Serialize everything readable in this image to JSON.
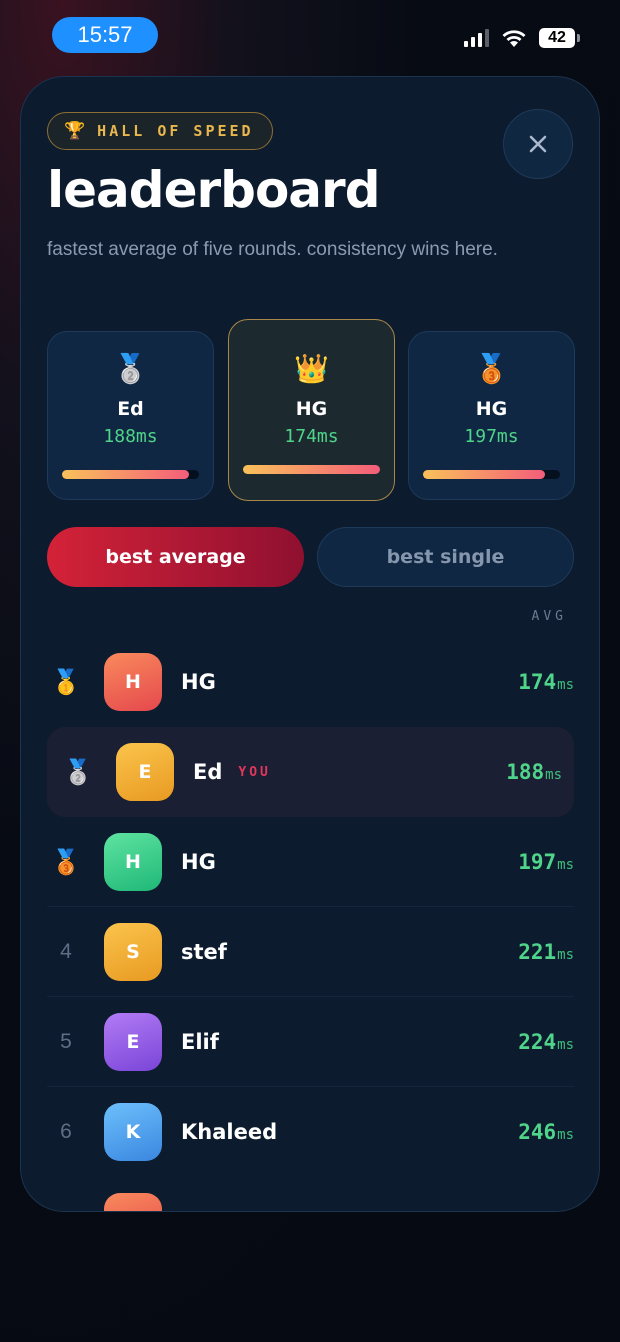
{
  "status_bar": {
    "time": "15:57",
    "battery": "42"
  },
  "header": {
    "badge_icon": "🏆",
    "badge_label": "HALL OF SPEED",
    "title": "leaderboard",
    "subtitle": "fastest average of five rounds. consistency wins here.",
    "close_icon": "close-icon"
  },
  "podium": [
    {
      "medal": "🥈",
      "name": "Ed",
      "time": "188ms",
      "progress": 0.93
    },
    {
      "medal": "👑",
      "name": "HG",
      "time": "174ms",
      "progress": 1.0
    },
    {
      "medal": "🥉",
      "name": "HG",
      "time": "197ms",
      "progress": 0.89
    }
  ],
  "tabs": {
    "active": "best average",
    "inactive": "best single"
  },
  "list_header": "AVG",
  "you_label": "YOU",
  "unit": "ms",
  "entries": [
    {
      "rank": "🥇",
      "initial": "H",
      "name": "HG",
      "score": "174",
      "color_from": "#f98a5c",
      "color_to": "#e5484d"
    },
    {
      "rank": "🥈",
      "initial": "E",
      "name": "Ed",
      "score": "188",
      "color_from": "#fbc44c",
      "color_to": "#e89a22",
      "you": true
    },
    {
      "rank": "🥉",
      "initial": "H",
      "name": "HG",
      "score": "197",
      "color_from": "#5fe3a1",
      "color_to": "#1fb877"
    },
    {
      "rank": "4",
      "initial": "S",
      "name": "stef",
      "score": "221",
      "color_from": "#fbc44c",
      "color_to": "#e89a22"
    },
    {
      "rank": "5",
      "initial": "E",
      "name": "Elif",
      "score": "224",
      "color_from": "#b27bf5",
      "color_to": "#7a45d8"
    },
    {
      "rank": "6",
      "initial": "K",
      "name": "Khaleed",
      "score": "246",
      "color_from": "#6cc0fb",
      "color_to": "#3a86e0"
    }
  ]
}
